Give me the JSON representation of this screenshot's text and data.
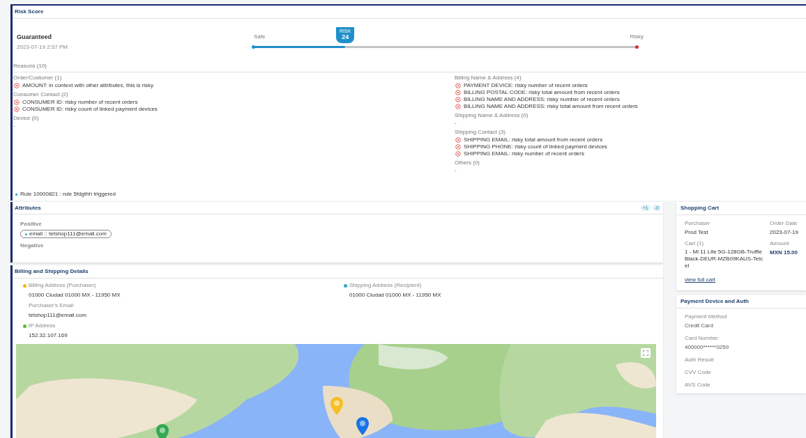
{
  "risk_score": {
    "title": "Risk Score",
    "status": "Guaranteed",
    "date": "2023-07-19 2:57 PM",
    "meter": {
      "safe_label": "Safe",
      "risky_label": "Risky",
      "badge_label": "RISK",
      "score": "24",
      "level": 0.24
    },
    "reasons_title": "Reasons (10)",
    "columns": [
      [
        {
          "title": "Order/Customer (1)",
          "items": [
            "AMOUNT: in context with other attributes, this is risky"
          ]
        },
        {
          "title": "Consumer Contact (2)",
          "items": [
            "CONSUMER ID: risky number of recent orders",
            "CONSUMER ID: risky count of linked payment devices"
          ]
        },
        {
          "title": "Device (0)",
          "empty": "-"
        }
      ],
      [
        {
          "title": "Billing Name & Address (4)",
          "items": [
            "PAYMENT DEVICE: risky number of recent orders",
            "BILLING POSTAL CODE: risky total amount from recent orders",
            "BILLING NAME AND ADDRESS: risky number of recent orders",
            "BILLING NAME AND ADDRESS: risky total amount from recent orders"
          ]
        },
        {
          "title": "Shipping Name & Address (0)",
          "empty": "-"
        },
        {
          "title": "Shipping Contact (3)",
          "items": [
            "SHIPPING EMAIL: risky total amount from recent orders",
            "SHIPPING PHONE: risky count of linked payment devices",
            "SHIPPING EMAIL: risky number of recent orders"
          ]
        },
        {
          "title": "Others (0)",
          "empty": "-"
        }
      ]
    ],
    "rule_text": "Rule 10000821 : rule 5fdgthh triggered"
  },
  "attributes": {
    "title": "Attributes",
    "counts": [
      "+1",
      "-0"
    ],
    "positive_label": "Positive",
    "positive_tags": [
      "email :: tetshop111@email.com"
    ],
    "negative_label": "Negative"
  },
  "billing_shipping": {
    "title": "Billing and Shipping Details",
    "columns": [
      [
        {
          "label": "Billing Address (Purchaser)",
          "value": "01000 Ciudad 01000 MX - 11950 MX",
          "color": "#f2b705"
        },
        {
          "label": "Purchaser's Email",
          "value": "tetshop111@email.com"
        },
        {
          "label": "IP Address",
          "value": "152.32.107.169",
          "color": "#5cb82e"
        }
      ],
      [
        {
          "label": "Shipping Address (Recipient)",
          "value": "01000 Ciudad 01000 MX - 11950 MX",
          "color": "#2aa7c0"
        }
      ]
    ],
    "map": {
      "kind": "picture"
    }
  },
  "shopping_cart": {
    "title": "Shopping Cart",
    "purchaser_label": "Purchaser",
    "purchaser": "Prod Test",
    "order_date_label": "Order Date",
    "order_date": "2023-07-19",
    "cart_label": "Cart (1)",
    "cart_item": "1 - Mi 11 Lite 5G-128GB-Truffle Black-DEUR-MZB09KAUS-Telcel",
    "cart_link": "view full cart",
    "amount_label": "Amount",
    "amount": "MXN 15.00"
  },
  "payment": {
    "title": "Payment Device and Auth",
    "fields": [
      {
        "label": "Payment Method",
        "value": "Credit Card"
      },
      {
        "label": "Card Number",
        "value": "400000******0259"
      },
      {
        "label": "Auth Result"
      },
      {
        "label": "CVV Code"
      },
      {
        "label": "AVS Code"
      }
    ]
  }
}
